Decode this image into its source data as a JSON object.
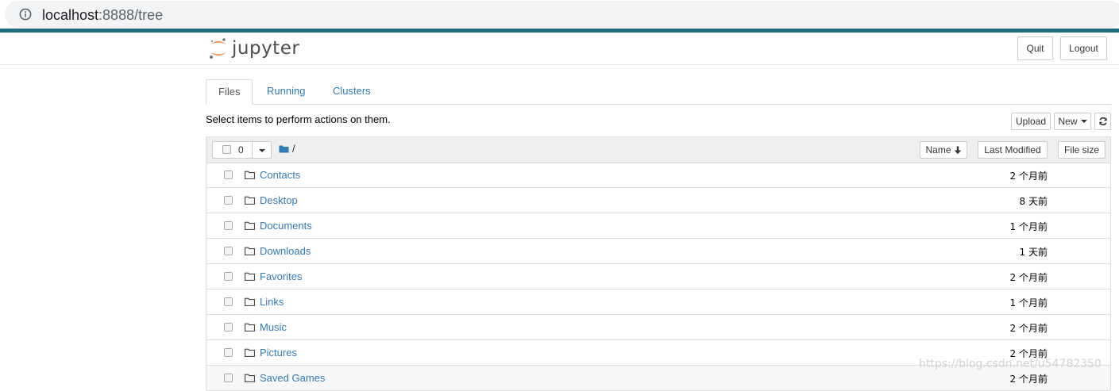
{
  "browser": {
    "url_host": "localhost",
    "url_rest": ":8888/tree"
  },
  "header": {
    "logo_text": "jupyter",
    "quit_label": "Quit",
    "logout_label": "Logout"
  },
  "tabs": [
    {
      "label": "Files",
      "active": true
    },
    {
      "label": "Running",
      "active": false
    },
    {
      "label": "Clusters",
      "active": false
    }
  ],
  "toolbar": {
    "hint": "Select items to perform actions on them.",
    "upload_label": "Upload",
    "new_label": "New",
    "refresh_icon": "refresh-icon"
  },
  "list_header": {
    "selected_count": "0",
    "breadcrumb": "/",
    "sort_name_label": "Name",
    "last_modified_label": "Last Modified",
    "file_size_label": "File size"
  },
  "files": [
    {
      "name": "Contacts",
      "modified": "2 个月前"
    },
    {
      "name": "Desktop",
      "modified": "8 天前"
    },
    {
      "name": "Documents",
      "modified": "1 个月前"
    },
    {
      "name": "Downloads",
      "modified": "1 天前"
    },
    {
      "name": "Favorites",
      "modified": "2 个月前"
    },
    {
      "name": "Links",
      "modified": "1 个月前"
    },
    {
      "name": "Music",
      "modified": "2 个月前"
    },
    {
      "name": "Pictures",
      "modified": "2 个月前"
    },
    {
      "name": "Saved Games",
      "modified": "2 个月前"
    }
  ],
  "watermark": "https://blog.csdn.net/u54782350",
  "colors": {
    "link": "#337ab7",
    "teal_bar": "#1e6e7e",
    "logo_orange": "#f37726"
  }
}
